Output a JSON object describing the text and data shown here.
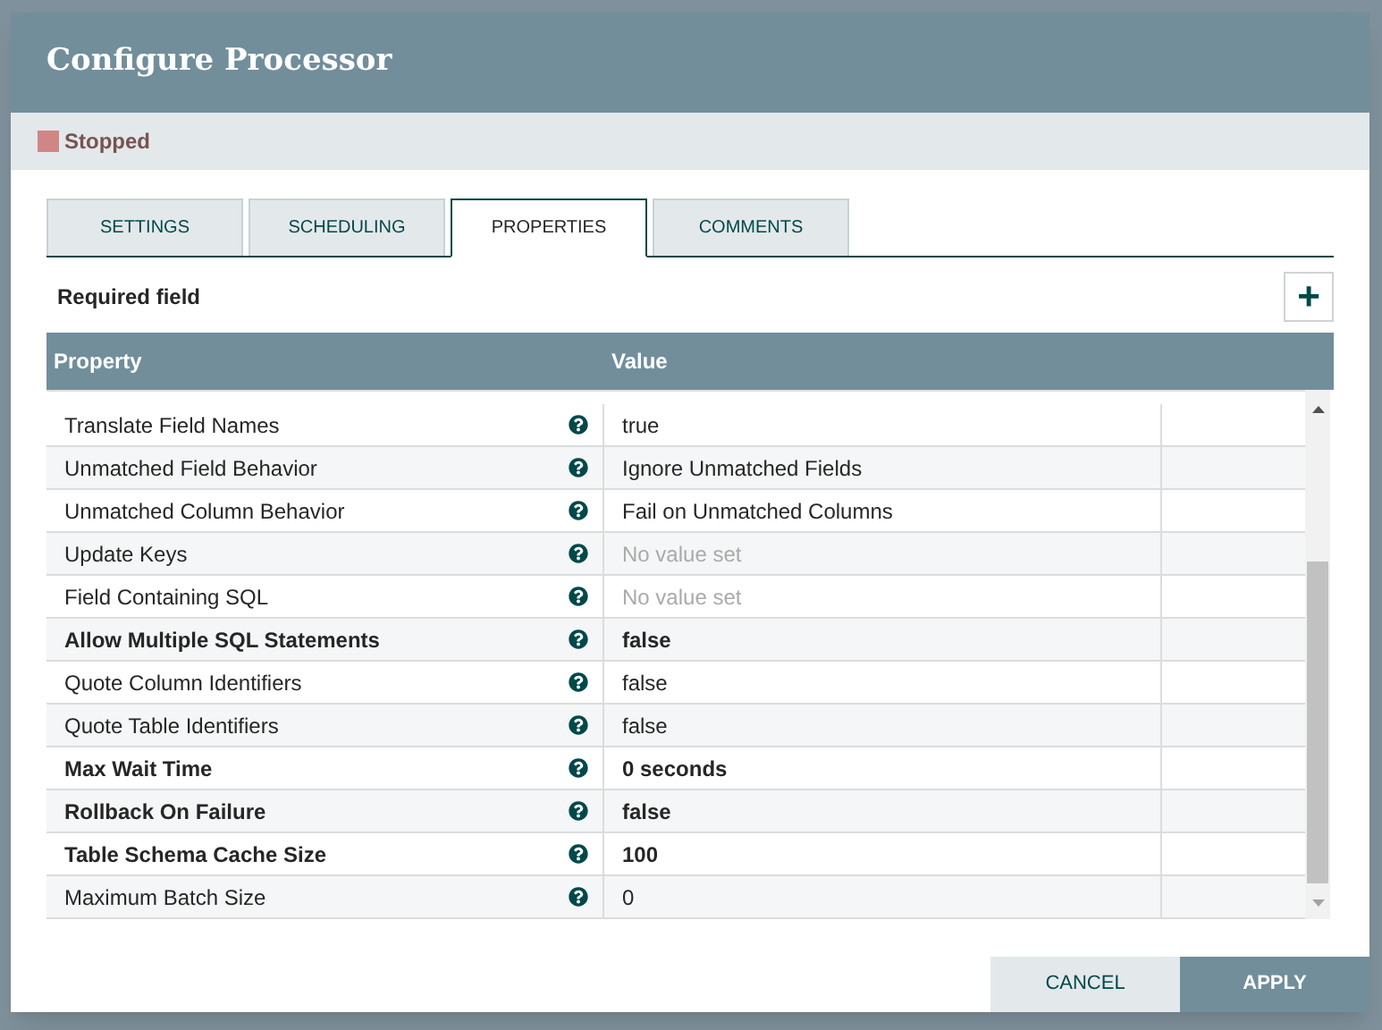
{
  "dialog": {
    "title": "Configure Processor"
  },
  "status": {
    "label": "Stopped",
    "color": "#d18686"
  },
  "tabs": [
    {
      "label": "SETTINGS",
      "selected": false
    },
    {
      "label": "SCHEDULING",
      "selected": false
    },
    {
      "label": "PROPERTIES",
      "selected": true
    },
    {
      "label": "COMMENTS",
      "selected": false
    }
  ],
  "required_note": "Required field",
  "add_button": "+",
  "table": {
    "columns": [
      "Property",
      "Value"
    ],
    "rows": [
      {
        "property": "Translate Field Names",
        "value": "true",
        "required": false,
        "set": true
      },
      {
        "property": "Unmatched Field Behavior",
        "value": "Ignore Unmatched Fields",
        "required": false,
        "set": true
      },
      {
        "property": "Unmatched Column Behavior",
        "value": "Fail on Unmatched Columns",
        "required": false,
        "set": true
      },
      {
        "property": "Update Keys",
        "value": "No value set",
        "required": false,
        "set": false
      },
      {
        "property": "Field Containing SQL",
        "value": "No value set",
        "required": false,
        "set": false
      },
      {
        "property": "Allow Multiple SQL Statements",
        "value": "false",
        "required": true,
        "set": true
      },
      {
        "property": "Quote Column Identifiers",
        "value": "false",
        "required": false,
        "set": true
      },
      {
        "property": "Quote Table Identifiers",
        "value": "false",
        "required": false,
        "set": true
      },
      {
        "property": "Max Wait Time",
        "value": "0 seconds",
        "required": true,
        "set": true
      },
      {
        "property": "Rollback On Failure",
        "value": "false",
        "required": true,
        "set": true
      },
      {
        "property": "Table Schema Cache Size",
        "value": "100",
        "required": true,
        "set": true
      },
      {
        "property": "Maximum Batch Size",
        "value": "0",
        "required": false,
        "set": true
      }
    ]
  },
  "buttons": [
    {
      "label": "CANCEL",
      "kind": "secondary"
    },
    {
      "label": "APPLY",
      "kind": "primary"
    }
  ]
}
